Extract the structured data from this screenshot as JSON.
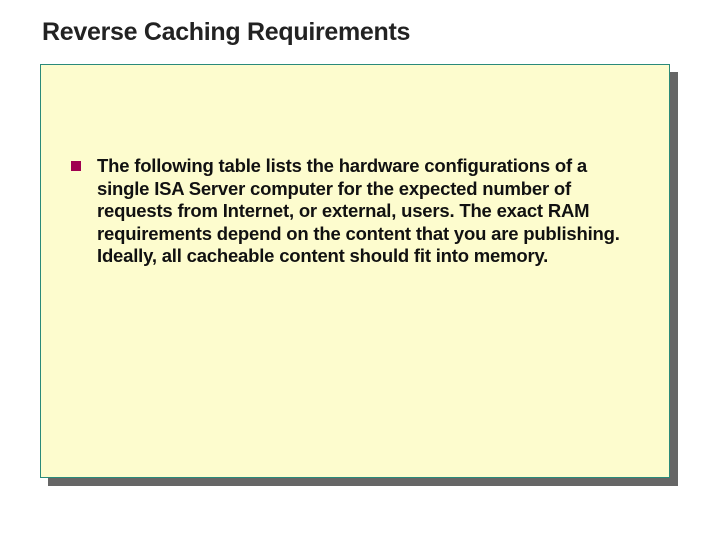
{
  "slide": {
    "title": "Reverse Caching Requirements",
    "body": "The following table lists the hardware configurations of a single ISA Server computer for the expected number of requests from Internet, or external, users. The exact RAM requirements depend on the content that you are publishing. Ideally, all cacheable content should fit into memory."
  }
}
